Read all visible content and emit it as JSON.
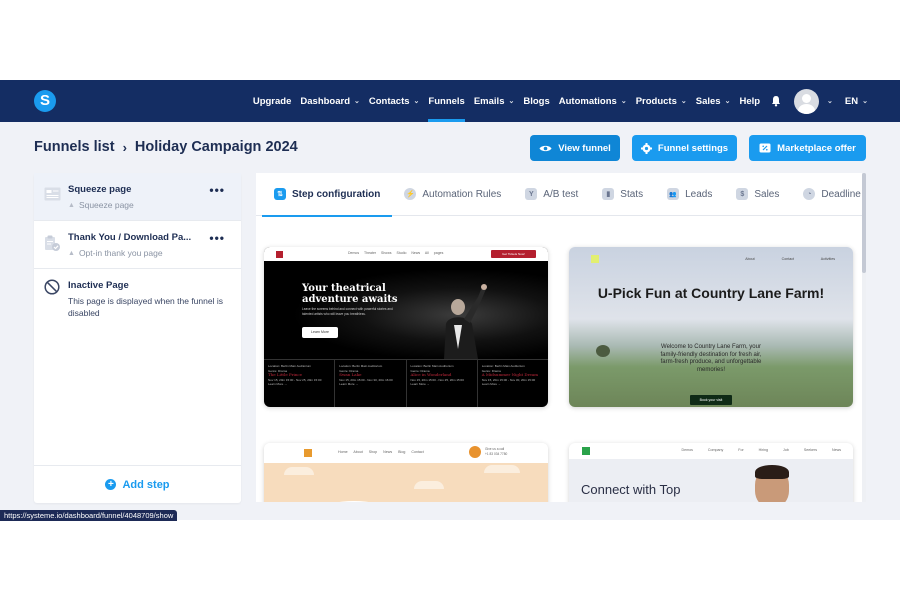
{
  "nav": {
    "brand_letter": "S",
    "items": [
      {
        "label": "Upgrade",
        "dropdown": false
      },
      {
        "label": "Dashboard",
        "dropdown": true
      },
      {
        "label": "Contacts",
        "dropdown": true
      },
      {
        "label": "Funnels",
        "dropdown": false,
        "active": true
      },
      {
        "label": "Emails",
        "dropdown": true
      },
      {
        "label": "Blogs",
        "dropdown": false
      },
      {
        "label": "Automations",
        "dropdown": true
      },
      {
        "label": "Products",
        "dropdown": true
      },
      {
        "label": "Sales",
        "dropdown": true
      },
      {
        "label": "Help",
        "dropdown": false
      }
    ],
    "language": "EN",
    "chevron": "⌄",
    "icons": {
      "bell": "bell-icon",
      "avatar": "user-avatar",
      "chevron": "chevron-down-icon"
    }
  },
  "header": {
    "breadcrumb_root": "Funnels list",
    "breadcrumb_sep": "›",
    "breadcrumb_current": "Holiday Campaign 2024",
    "buttons": {
      "view_funnel": "View funnel",
      "funnel_settings": "Funnel settings",
      "marketplace_offer": "Marketplace offer"
    }
  },
  "steps": [
    {
      "title": "Squeeze page",
      "subtitle": "Squeeze page",
      "selected": true,
      "icon": "page-layout-icon"
    },
    {
      "title": "Thank You / Download Pa...",
      "subtitle": "Opt-in thank you page",
      "selected": false,
      "icon": "clipboard-check-icon"
    },
    {
      "title": "Inactive Page",
      "description": "This page is displayed when the funnel is disabled",
      "icon": "disabled-icon"
    }
  ],
  "steps_more": "•••",
  "warning_glyph": "▲",
  "add_step_label": "Add step",
  "tabs": [
    {
      "label": "Step configuration",
      "active": true,
      "glyph": "⇅"
    },
    {
      "label": "Automation Rules",
      "glyph": "⚡"
    },
    {
      "label": "A/B test",
      "glyph": "Y"
    },
    {
      "label": "Stats",
      "glyph": "▮"
    },
    {
      "label": "Leads",
      "glyph": "👥"
    },
    {
      "label": "Sales",
      "glyph": "$"
    },
    {
      "label": "Deadline settings",
      "glyph": "◔"
    }
  ],
  "templates": {
    "theater": {
      "nav_links": "Demos Theater Shows Studio News All pages",
      "cta": "Get Tickets Now!",
      "headline_1": "Your theatrical",
      "headline_2": "adventure awaits",
      "paragraph": "Leave the screens behind and connect with powerful stories and talented artists who will leave you breathless.",
      "learn_more": "Learn More",
      "events": [
        {
          "location": "Location: Berlin Main Auditorium",
          "genre": "Genre: Drama",
          "title": "The Little Prince",
          "dates": "Nov 15, 20m 15:00 - Nov 25, 20m 15:00",
          "link": "Learn More →"
        },
        {
          "location": "Location: Berlin Main Auditorium",
          "genre": "Genre: Drama",
          "title": "Swan Lake",
          "dates": "Nov 15, 20m 15:00 - Nov 30, 20m 16:00",
          "link": "Learn More →"
        },
        {
          "location": "Location: Berlin Main Auditorium",
          "genre": "Genre: Drama",
          "title": "Alice in Wonderland",
          "dates": "Nov 15, 20m 15:00 - Nov 25, 20m 15:00",
          "link": "Learn More →"
        },
        {
          "location": "Location: Berlin Main Auditorium",
          "genre": "Genre: Drama",
          "title": "A Midsummer Night Dream",
          "dates": "Nov 15, 20m 15:00 - Nov 30, 20m 15:00",
          "link": "Learn More →"
        }
      ]
    },
    "farm": {
      "nav_links": "About Contact Activities",
      "headline": "U-Pick Fun at Country Lane Farm!",
      "paragraph": "Welcome to Country Lane Farm, your family-friendly destination for fresh air, farm-fresh produce, and unforgettable memories!",
      "cta": "Book your visit"
    },
    "orange": {
      "nav_links": "Home About Shop News Blog Contact",
      "phone_label": "Give us a call",
      "phone_number": "+1 83 034 7780"
    },
    "business": {
      "nav_links": "Demos Company For Hiring Job Seekers News",
      "headline": "Connect with Top"
    }
  },
  "help_label": "?",
  "status_url": "https://systeme.io/dashboard/funnel/4048709/show"
}
